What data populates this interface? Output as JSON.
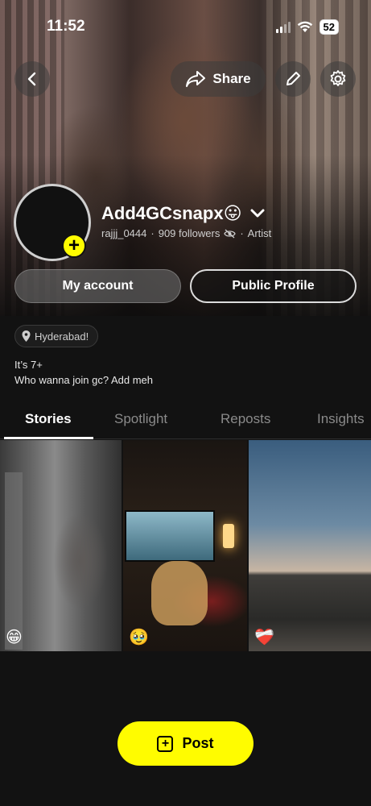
{
  "status_bar": {
    "time": "11:52",
    "battery": "52"
  },
  "header": {
    "share_label": "Share"
  },
  "profile": {
    "display_name": "Add4GCsnapx😛",
    "username": "rajjj_0444",
    "followers": "909 followers",
    "category": "Artist",
    "my_account_label": "My account",
    "public_profile_label": "Public Profile"
  },
  "bio": {
    "location": "Hyderabad!",
    "line1": "It’s 7+",
    "line2": "Who wanna join gc? Add meh"
  },
  "tabs": [
    {
      "label": "Stories",
      "active": true
    },
    {
      "label": "Spotlight",
      "active": false
    },
    {
      "label": "Reposts",
      "active": false
    },
    {
      "label": "Insights",
      "active": false
    }
  ],
  "stories": [
    {
      "emoji": "😁"
    },
    {
      "emoji": "🥹"
    },
    {
      "emoji": "❤️‍🩹"
    }
  ],
  "post_button": {
    "label": "Post"
  },
  "colors": {
    "accent": "#FFFC00",
    "background": "#121212"
  }
}
